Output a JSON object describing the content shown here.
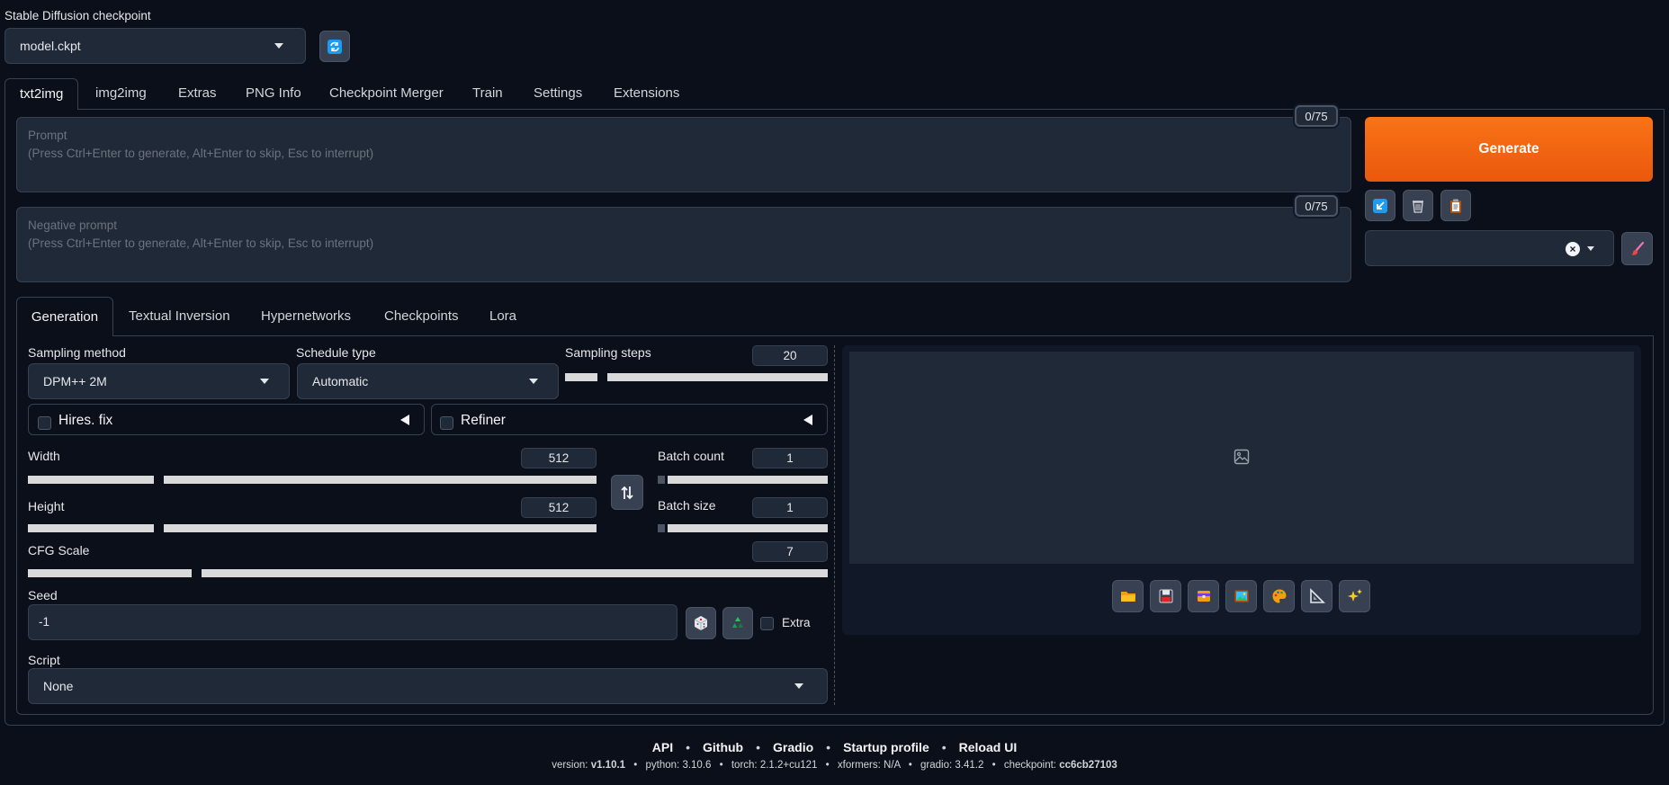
{
  "checkpoint": {
    "label": "Stable Diffusion checkpoint",
    "value": "model.ckpt"
  },
  "main_tabs": [
    "txt2img",
    "img2img",
    "Extras",
    "PNG Info",
    "Checkpoint Merger",
    "Train",
    "Settings",
    "Extensions"
  ],
  "prompt": {
    "placeholder_line1": "Prompt",
    "placeholder_line2": "(Press Ctrl+Enter to generate, Alt+Enter to skip, Esc to interrupt)",
    "counter": "0/75"
  },
  "negative_prompt": {
    "placeholder_line1": "Negative prompt",
    "placeholder_line2": "(Press Ctrl+Enter to generate, Alt+Enter to skip, Esc to interrupt)",
    "counter": "0/75"
  },
  "generate_label": "Generate",
  "sub_tabs": [
    "Generation",
    "Textual Inversion",
    "Hypernetworks",
    "Checkpoints",
    "Lora"
  ],
  "sampling_method": {
    "label": "Sampling method",
    "value": "DPM++ 2M"
  },
  "schedule_type": {
    "label": "Schedule type",
    "value": "Automatic"
  },
  "sampling_steps": {
    "label": "Sampling steps",
    "value": "20"
  },
  "hires_fix": {
    "label": "Hires. fix"
  },
  "refiner": {
    "label": "Refiner"
  },
  "width": {
    "label": "Width",
    "value": "512"
  },
  "height": {
    "label": "Height",
    "value": "512"
  },
  "batch_count": {
    "label": "Batch count",
    "value": "1"
  },
  "batch_size": {
    "label": "Batch size",
    "value": "1"
  },
  "cfg_scale": {
    "label": "CFG Scale",
    "value": "7"
  },
  "seed": {
    "label": "Seed",
    "value": "-1",
    "extra_label": "Extra"
  },
  "script": {
    "label": "Script",
    "value": "None"
  },
  "footer": {
    "links": [
      "API",
      "Github",
      "Gradio",
      "Startup profile",
      "Reload UI"
    ],
    "version_label": "version:",
    "version": "v1.10.1",
    "python_label": "python:",
    "python": "3.10.6",
    "torch_label": "torch:",
    "torch": "2.1.2+cu121",
    "xformers_label": "xformers:",
    "xformers": "N/A",
    "gradio_label": "gradio:",
    "gradio": "3.41.2",
    "checkpoint_label": "checkpoint:",
    "checkpoint": "cc6cb27103"
  },
  "colors": {
    "accent": "#f97316",
    "accent_dark": "#ea580c",
    "bg": "#0b0f19",
    "panel": "#1f2937"
  }
}
